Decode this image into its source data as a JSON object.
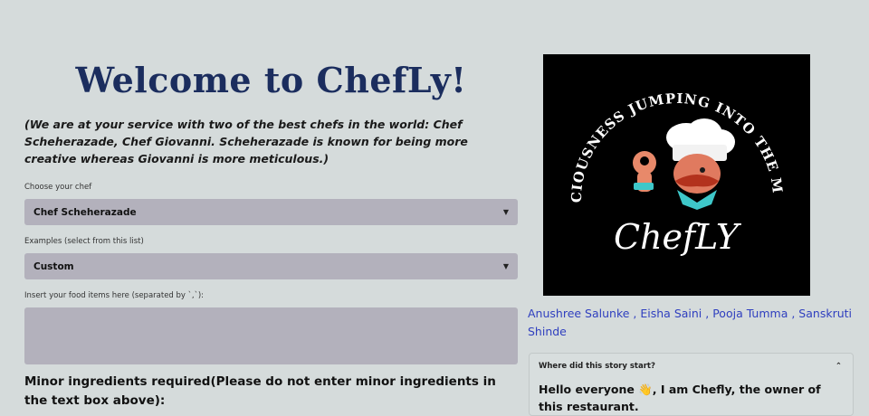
{
  "header": {
    "title": "Welcome to ChefLy!",
    "intro": "(We are at your service with two of the best chefs in the world: Chef Scheherazade, Chef Giovanni. Scheherazade is known for being more creative whereas Giovanni is more meticulous.)"
  },
  "form": {
    "chef_label": "Choose your chef",
    "chef_value": "Chef Scheherazade",
    "examples_label": "Examples (select from this list)",
    "examples_value": "Custom",
    "food_label": "Insert your food items here (separated by `,`):",
    "food_value": "",
    "minor_heading": "Minor ingredients required(Please do not enter minor ingredients in the text box above):"
  },
  "logo": {
    "arc_text": "DELICIOUSNESS JUMPING INTO THE MOUTH",
    "brand": "ChefLY",
    "icon": "chef-mascot-icon"
  },
  "authors": [
    "Anushree Salunke",
    "Eisha Saini",
    "Pooja Tumma",
    "Sanskruti Shinde"
  ],
  "story": {
    "header": "Where did this story start?",
    "body_before": "Hello everyone ",
    "emoji": "👋",
    "body_after": ", I am Chefly, the owner of this restaurant."
  },
  "colors": {
    "background": "#d5dbdb",
    "title": "#1b2d5e",
    "input_bg": "#b3b1bc",
    "link": "#2f3fbf",
    "logo_bg": "#000000"
  }
}
